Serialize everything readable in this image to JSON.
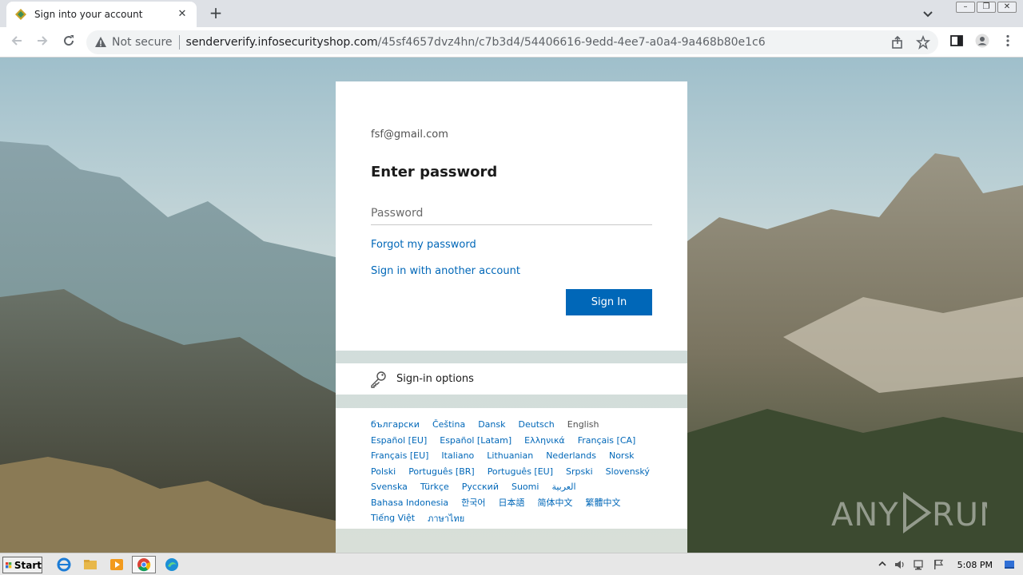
{
  "browser": {
    "tab_title": "Sign into your account",
    "not_secure_label": "Not secure",
    "url_host": "senderverify.infosecurityshop.com",
    "url_path": "/45sf4657dvz4hn/c7b3d4/54406616-9edd-4ee7-a0a4-9a468b80e1c6"
  },
  "signin": {
    "email": "fsf@gmail.com",
    "heading": "Enter password",
    "password_placeholder": "Password",
    "forgot_link": "Forgot my password",
    "another_account_link": "Sign in with another account",
    "signin_button": "Sign In",
    "options_label": "Sign-in options"
  },
  "languages": [
    [
      "български",
      "Čeština",
      "Dansk",
      "Deutsch",
      "English"
    ],
    [
      "Español [EU]",
      "Español [Latam]",
      "Ελληνικά",
      "Français [CA]"
    ],
    [
      "Français [EU]",
      "Italiano",
      "Lithuanian",
      "Nederlands",
      "Norsk"
    ],
    [
      "Polski",
      "Português [BR]",
      "Português [EU]",
      "Srpski",
      "Slovenský"
    ],
    [
      "Svenska",
      "Türkçe",
      "Русский",
      "Suomi",
      "العربية"
    ],
    [
      "Bahasa Indonesia",
      "한국어",
      "日本語",
      "简体中文",
      "繁體中文"
    ],
    [
      "Tiếng Việt",
      "ภาษาไทย"
    ]
  ],
  "current_language": "English",
  "watermark": "ANY RUN",
  "taskbar": {
    "start_label": "Start",
    "clock": "5:08 PM"
  },
  "colors": {
    "accent": "#0067b8",
    "button_text": "#ffffff"
  }
}
